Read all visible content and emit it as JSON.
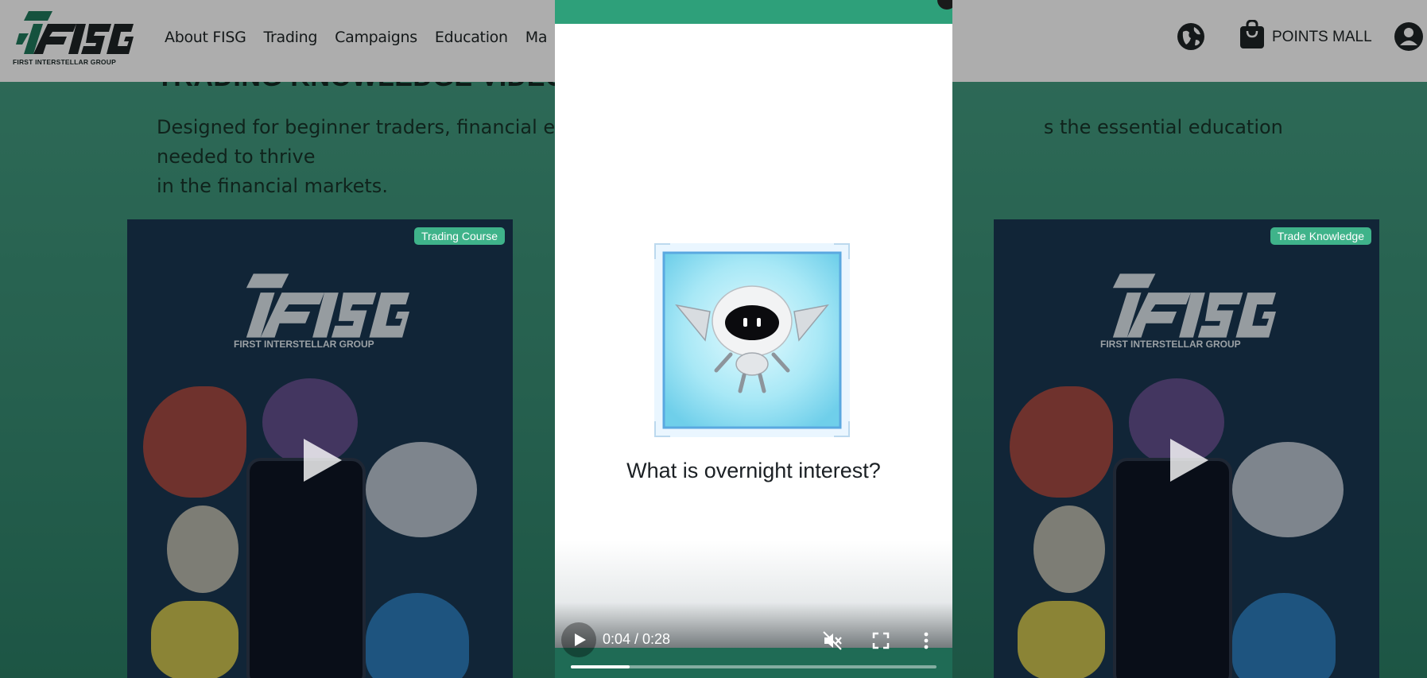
{
  "header": {
    "logo_subtitle": "FIRST INTERSTELLAR GROUP",
    "nav": [
      "About FISG",
      "Trading",
      "Campaigns",
      "Education",
      "Ma"
    ],
    "points_label": "POINTS MALL"
  },
  "section": {
    "title": "TRADING KNOWLEDGE VIDEO",
    "description": "Designed for beginner traders, financial ent",
    "description_tail": "s the essential education needed to thrive",
    "description_line2": "in the financial markets."
  },
  "cards": [
    {
      "tag": "Trading Course",
      "cover_subtitle": "FIRST INTERSTELLAR GROUP"
    },
    {
      "tag": "Trade Knowledge",
      "cover_subtitle": "FIRST INTERSTELLAR GROUP"
    }
  ],
  "modal": {
    "question": "What is overnight interest?",
    "time": "0:04 / 0:28",
    "progress": 0.16
  },
  "colors": {
    "brand_green": "#2ea07a",
    "tag_green": "#3fb38a"
  }
}
